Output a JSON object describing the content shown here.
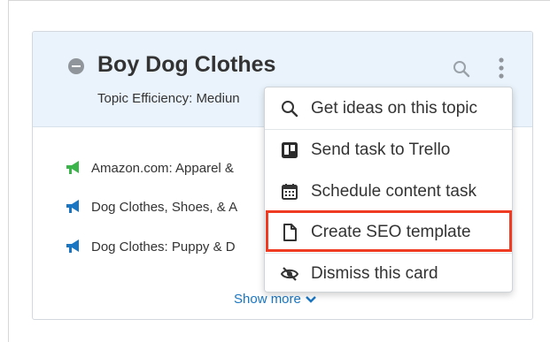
{
  "card": {
    "title": "Boy Dog Clothes",
    "topic_efficiency": "Topic Efficiency:  Mediun"
  },
  "list_items": [
    {
      "text": "Amazon.com: Apparel &",
      "icon": "megaphone-icon",
      "color": "#3bb54a"
    },
    {
      "text": "Dog Clothes, Shoes, & A",
      "icon": "megaphone-icon",
      "color": "#1a76c2"
    },
    {
      "text": "Dog Clothes: Puppy & D",
      "icon": "megaphone-icon",
      "color": "#1a76c2"
    }
  ],
  "show_more": "Show more",
  "menu": {
    "items": [
      {
        "label": "Get ideas on this topic",
        "icon": "search-icon"
      },
      {
        "label": "Send task to Trello",
        "icon": "trello-icon"
      },
      {
        "label": "Schedule content task",
        "icon": "calendar-icon"
      },
      {
        "label": "Create SEO template",
        "icon": "document-icon"
      },
      {
        "label": "Dismiss this card",
        "icon": "eye-slash-icon"
      }
    ]
  },
  "colors": {
    "header_bg": "#eaf3fb",
    "link": "#1a76c2",
    "highlight": "#ee3b22",
    "accent_green": "#3bb54a"
  }
}
